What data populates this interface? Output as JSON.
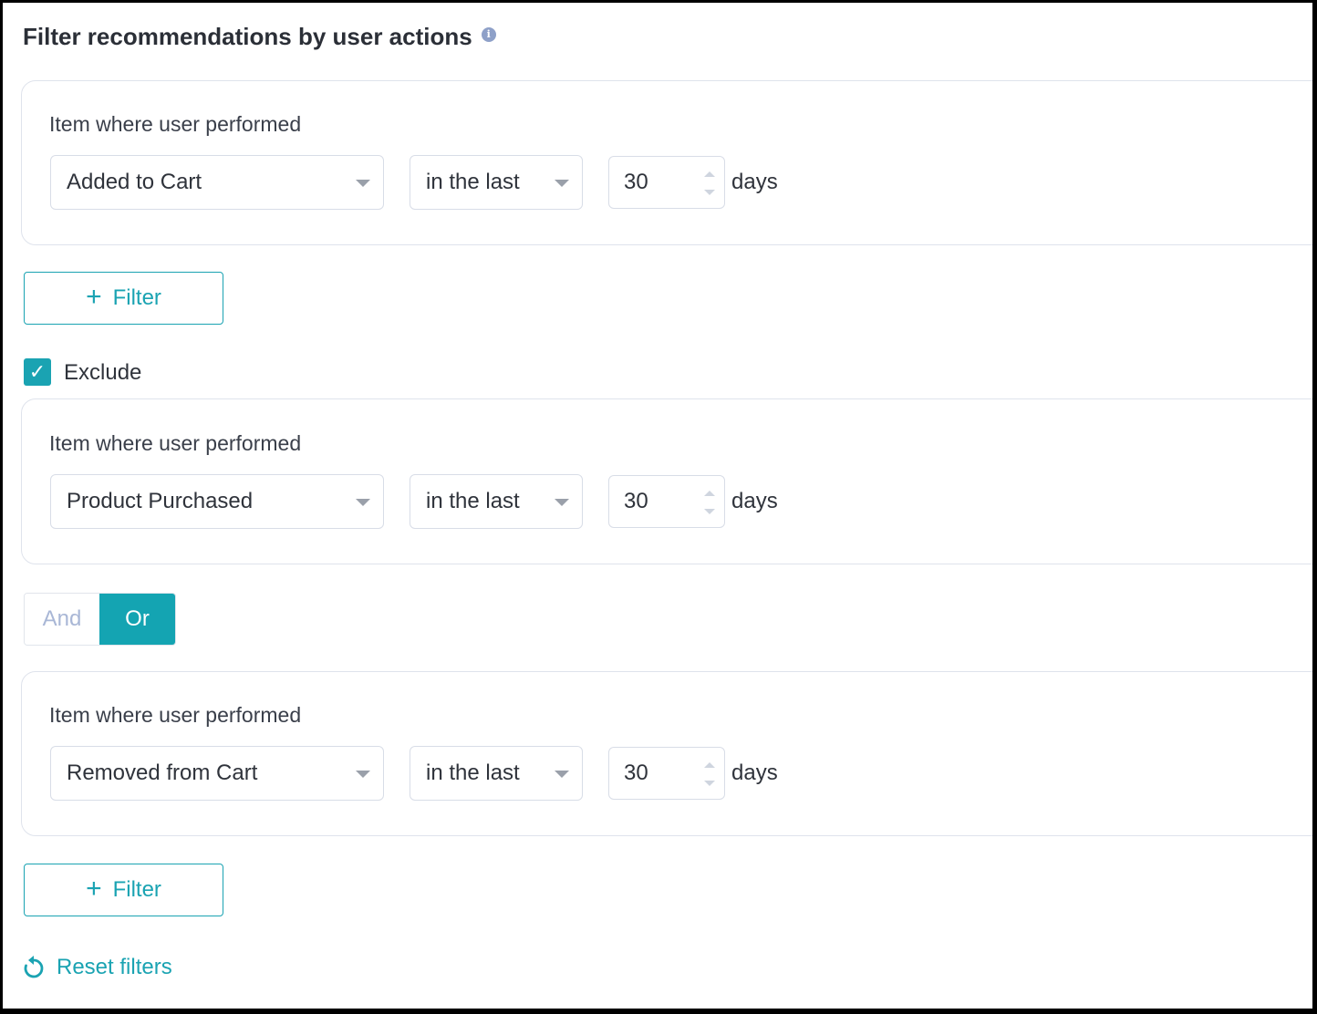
{
  "title": "Filter recommendations by user actions",
  "info_icon": "info-icon",
  "panels": [
    {
      "label": "Item where user performed",
      "action": "Added to Cart",
      "timeframe": "in the last",
      "count": "30",
      "unit": "days"
    },
    {
      "label": "Item where user performed",
      "action": "Product Purchased",
      "timeframe": "in the last",
      "count": "30",
      "unit": "days"
    },
    {
      "label": "Item where user performed",
      "action": "Removed from Cart",
      "timeframe": "in the last",
      "count": "30",
      "unit": "days"
    }
  ],
  "add_filter_label": "Filter",
  "exclude": {
    "label": "Exclude",
    "checked": true
  },
  "logic_toggle": {
    "and_label": "And",
    "or_label": "Or",
    "selected": "Or"
  },
  "reset_label": "Reset filters",
  "colors": {
    "accent": "#1aa3b2",
    "toggle_active": "#14a4b2",
    "border": "#dfe3ec",
    "info_icon": "#8ea0c8"
  }
}
